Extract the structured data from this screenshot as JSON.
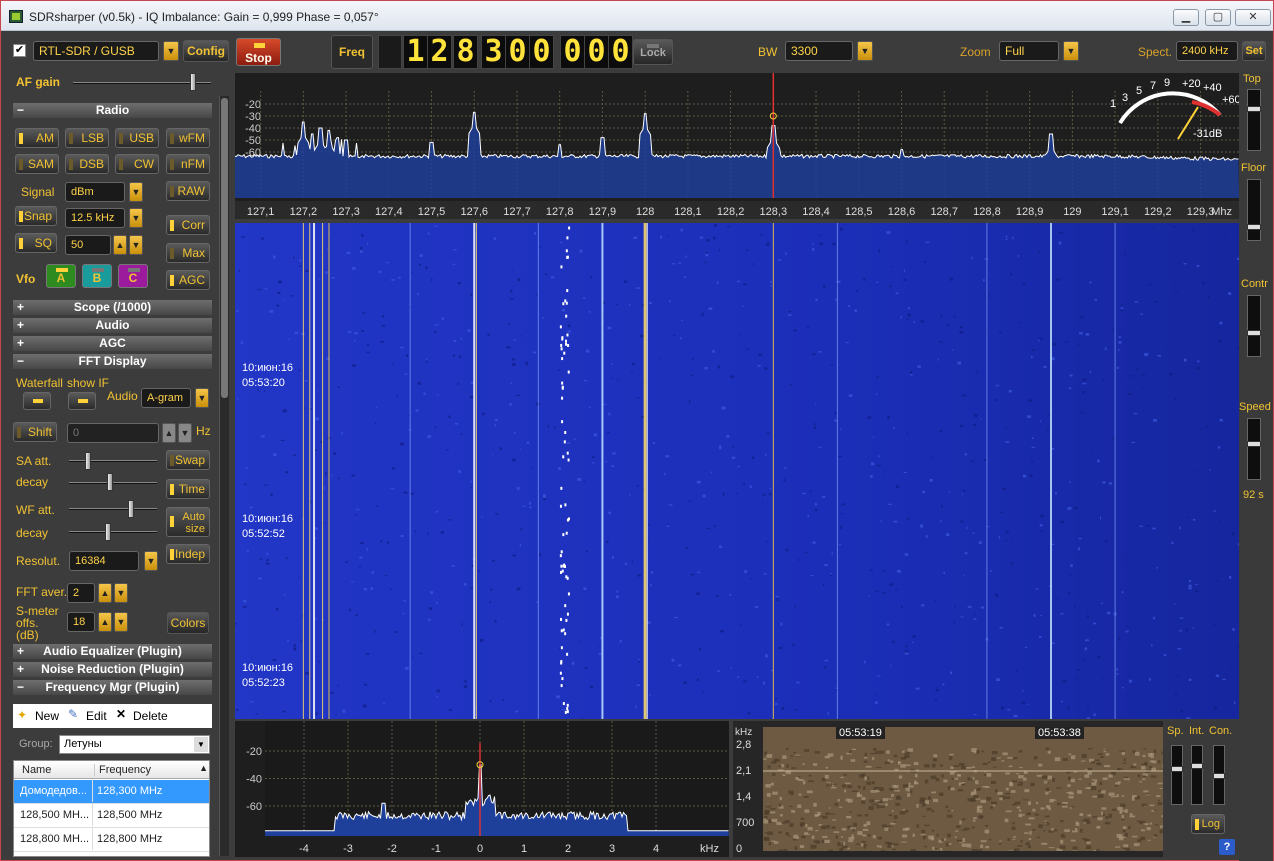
{
  "window": {
    "title": "SDRsharper (v0.5k) - IQ Imbalance: Gain = 0,999 Phase = 0,057°",
    "min": "▁",
    "max": "▢",
    "close": "✕"
  },
  "toolbar": {
    "device": "RTL-SDR / GUSB",
    "config": "Config",
    "stop": "Stop",
    "freq_label": "Freq",
    "digits": [
      "1",
      "2",
      "8",
      "3",
      "0",
      "0",
      "0",
      "0",
      "0"
    ],
    "lock": "Lock",
    "bw_label": "BW",
    "bw": "3300",
    "zoom_label": "Zoom",
    "zoom": "Full",
    "spect_label": "Spect.",
    "spect": "2400 kHz",
    "set": "Set"
  },
  "left": {
    "af_gain": "AF gain",
    "af_gain_level": 0.9,
    "radio": "Radio",
    "modes": [
      "AM",
      "LSB",
      "USB",
      "wFM",
      "SAM",
      "DSB",
      "CW",
      "nFM"
    ],
    "raw": "RAW",
    "signal_label": "Signal",
    "signal": "dBm",
    "snap": "Snap",
    "snap_val": "12.5 kHz",
    "corr": "Corr",
    "sq": "SQ",
    "sq_val": "50",
    "max": "Max",
    "agc": "AGC",
    "vfo_label": "Vfo",
    "vfos": [
      "A",
      "B",
      "C"
    ],
    "sections": {
      "scope": "Scope (/1000)",
      "audio": "Audio",
      "agc": "AGC",
      "fft": "FFT Display",
      "eq": "Audio Equalizer (Plugin)",
      "nr": "Noise Reduction (Plugin)",
      "fm": "Frequency Mgr (Plugin)"
    },
    "waterfall": "Waterfall",
    "show_if": "show IF",
    "audio_lbl": "Audio",
    "agram": "A-gram",
    "shift": "Shift",
    "shift_val": "0",
    "hz": "Hz",
    "sa_att": "SA att.",
    "decay": "decay",
    "wf_att": "WF att.",
    "decay2": "decay",
    "swap": "Swap",
    "time": "Time",
    "autosize": "Auto size",
    "indep": "Indep",
    "resolut": "Resolut.",
    "resolut_val": "16384",
    "fft_aver": "FFT aver.",
    "fft_aver_val": "2",
    "smeter": "S-meter offs. (dB)",
    "smeter_val": "18",
    "colors": "Colors",
    "fm_new": "New",
    "fm_edit": "Edit",
    "fm_delete": "Delete",
    "group_label": "Group:",
    "group": "Летуны",
    "cols": [
      "Name",
      "Frequency"
    ],
    "rows": [
      [
        "Домодедов...",
        "128,300 MHz"
      ],
      [
        "128,500 MH...",
        "128,500 MHz"
      ],
      [
        "128,800 MH...",
        "128,800 MHz"
      ]
    ]
  },
  "spectrum": {
    "db_ticks": [
      "-20",
      "-30",
      "-40",
      "-50",
      "-60"
    ],
    "freq_ticks": [
      "127,1",
      "127,2",
      "127,3",
      "127,4",
      "127,5",
      "127,6",
      "127,7",
      "127,8",
      "127,9",
      "128",
      "128,1",
      "128,2",
      "128,3",
      "128,4",
      "128,5",
      "128,6",
      "128,7",
      "128,8",
      "128,9",
      "129",
      "129,1",
      "129,2",
      "129,3"
    ],
    "unit": "Mhz",
    "meter_scale": [
      "1",
      "3",
      "5",
      "7",
      "9",
      "+20",
      "+40",
      "+60"
    ],
    "meter_val": "-31dB"
  },
  "waterfall": {
    "stamps": [
      [
        "10:июн:16",
        "05:53:20"
      ],
      [
        "10:июн:16",
        "05:52:52"
      ],
      [
        "10:июн:16",
        "05:52:23"
      ]
    ]
  },
  "iq": {
    "db_ticks": [
      "-20",
      "-40",
      "-60"
    ],
    "x_ticks": [
      "-4",
      "-3",
      "-2",
      "-1",
      "0",
      "1",
      "2",
      "3",
      "4"
    ],
    "unit": "kHz"
  },
  "agram": {
    "y_unit": "kHz",
    "y_ticks": [
      "2,8",
      "2,1",
      "1,4",
      "700",
      "0"
    ],
    "times": [
      "05:53:19",
      "05:53:38"
    ],
    "sp": "Sp.",
    "int": "Int.",
    "con": "Con.",
    "log": "Log",
    "help": "?"
  },
  "right": {
    "top": "Top",
    "floor": "Floor",
    "contr": "Contr",
    "speed": "Speed",
    "speed_val": "92 s"
  }
}
